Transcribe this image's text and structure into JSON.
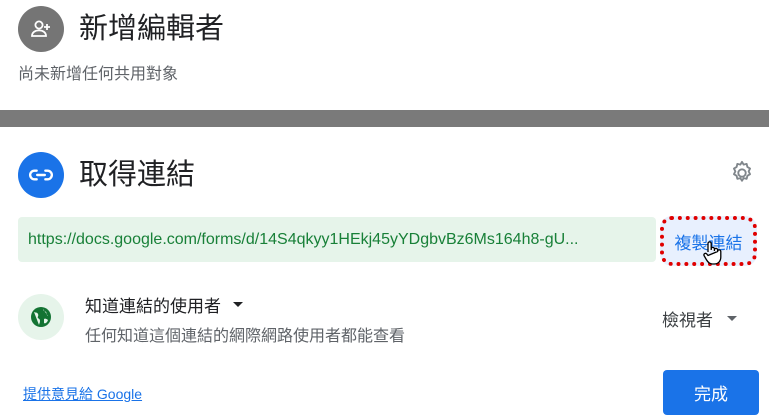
{
  "add_editors": {
    "title": "新增編輯者",
    "subtitle": "尚未新增任何共用對象",
    "icon": "person-add-icon"
  },
  "get_link": {
    "title": "取得連結",
    "icon": "link-icon",
    "settings_icon": "gear-icon",
    "url": "https://docs.google.com/forms/d/14S4qkyy1HEkj45yYDgbvBz6Ms164h8-gU...",
    "copy_label": "複製連結",
    "access": {
      "icon": "globe-icon",
      "label": "知道連結的使用者",
      "description": "任何知道這個連結的網際網路使用者都能查看"
    },
    "role": "檢視者"
  },
  "footer": {
    "feedback": "提供意見給 Google",
    "done": "完成"
  },
  "colors": {
    "accent": "#1a73e8",
    "link_green": "#188038",
    "url_bg": "#e6f4ea",
    "highlight_dots": "#e00000"
  }
}
